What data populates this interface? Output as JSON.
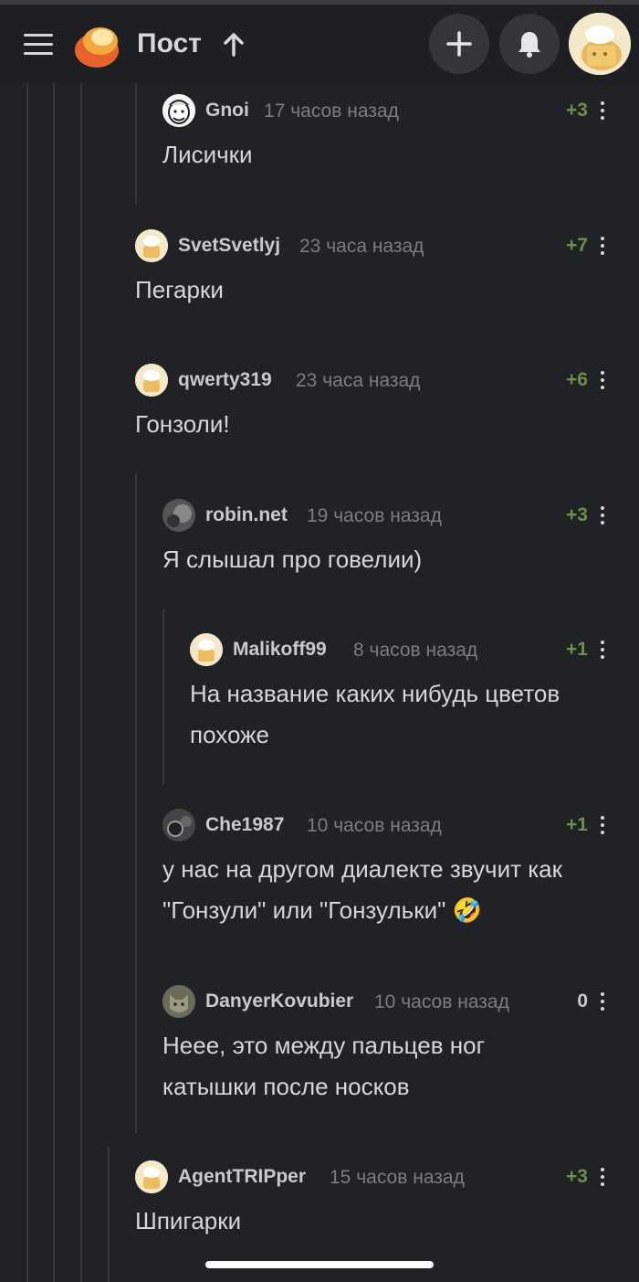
{
  "header": {
    "title": "Пост",
    "icons": {
      "menu": "hamburger-menu-icon",
      "logo": "pikabu-logo",
      "up": "arrow-up-icon",
      "add": "plus-icon",
      "notifications": "bell-icon",
      "profile": "user-avatar"
    }
  },
  "colors": {
    "background": "#202226",
    "header": "#1d1f22",
    "score_positive": "#6e8f4a",
    "text": "#d6d7d9",
    "muted": "#7b7d81"
  },
  "comments": [
    {
      "author": "Gnoi",
      "time": "17 часов назад",
      "score": "+3",
      "text": "Лисички",
      "depth": 3
    },
    {
      "author": "SvetSvetlyj",
      "time": "23 часа назад",
      "score": "+7",
      "text": "Пегарки",
      "depth": 2
    },
    {
      "author": "qwerty319",
      "time": "23 часа назад",
      "score": "+6",
      "text": "Гонзоли!",
      "depth": 2
    },
    {
      "author": "robin.net",
      "time": "19 часов назад",
      "score": "+3",
      "text": "Я слышал про говелии)",
      "depth": 3
    },
    {
      "author": "Malikoff99",
      "time": "8 часов назад",
      "score": "+1",
      "text": "На название каких нибудь цветов похоже",
      "depth": 4
    },
    {
      "author": "Che1987",
      "time": "10 часов назад",
      "score": "+1",
      "text": "у нас на другом диалекте звучит как \"Гонзули\" или \"Гонзульки\" 🤣",
      "depth": 3
    },
    {
      "author": "DanyerKovubier",
      "time": "10 часов назад",
      "score": "0",
      "text": "Неее, это между пальцев ног катышки после носков",
      "depth": 3
    },
    {
      "author": "AgentTRIPper",
      "time": "15 часов назад",
      "score": "+3",
      "text": "Шпигарки",
      "depth": 2
    }
  ]
}
